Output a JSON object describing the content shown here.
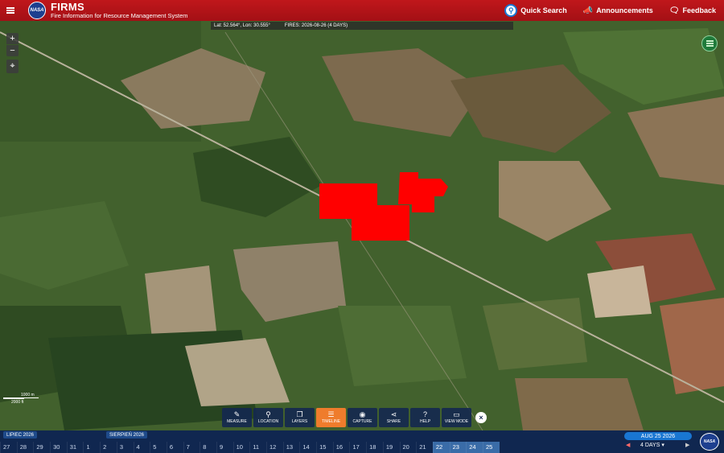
{
  "header": {
    "title": "FIRMS",
    "subtitle": "Fire Information for Resource Management System",
    "logo_text": "NASA",
    "quick_search": "Quick Search",
    "announcements": "Announcements",
    "feedback": "Feedback"
  },
  "coordbar": {
    "coords": "Lat: 52.564°, Lon: 30.555°",
    "fires": "FIRES: 2026-08-26 (4 DAYS)"
  },
  "map_controls": {
    "zoom_in": "+",
    "zoom_out": "−",
    "locate": "⌖"
  },
  "scale": {
    "metric": "1000 m",
    "imperial": "2000 ft"
  },
  "toolbar": {
    "items": [
      {
        "label": "MEASURE",
        "icon": "✎"
      },
      {
        "label": "LOCATION",
        "icon": "⚲"
      },
      {
        "label": "LAYERS",
        "icon": "❐"
      },
      {
        "label": "TIMELINE",
        "icon": "☰"
      },
      {
        "label": "CAPTURE",
        "icon": "◉"
      },
      {
        "label": "SHARE",
        "icon": "⋖"
      },
      {
        "label": "HELP",
        "icon": "?"
      },
      {
        "label": "VIEW MODE",
        "icon": "▭"
      }
    ],
    "active": "TIMELINE",
    "close": "×"
  },
  "timeline": {
    "month1": "LIPIEC 2026",
    "month2": "SIERPIEŃ 2026",
    "days": [
      "27",
      "28",
      "29",
      "30",
      "31",
      "1",
      "2",
      "3",
      "4",
      "5",
      "6",
      "7",
      "8",
      "9",
      "10",
      "11",
      "12",
      "13",
      "14",
      "15",
      "16",
      "17",
      "18",
      "19",
      "20",
      "21",
      "22",
      "23",
      "24",
      "25"
    ],
    "selected_days": [
      "22",
      "23",
      "24",
      "25"
    ],
    "date": "AUG 25 2026",
    "range": "4 DAYS",
    "prev": "◀",
    "next": "▶",
    "logo_text": "NASA"
  }
}
